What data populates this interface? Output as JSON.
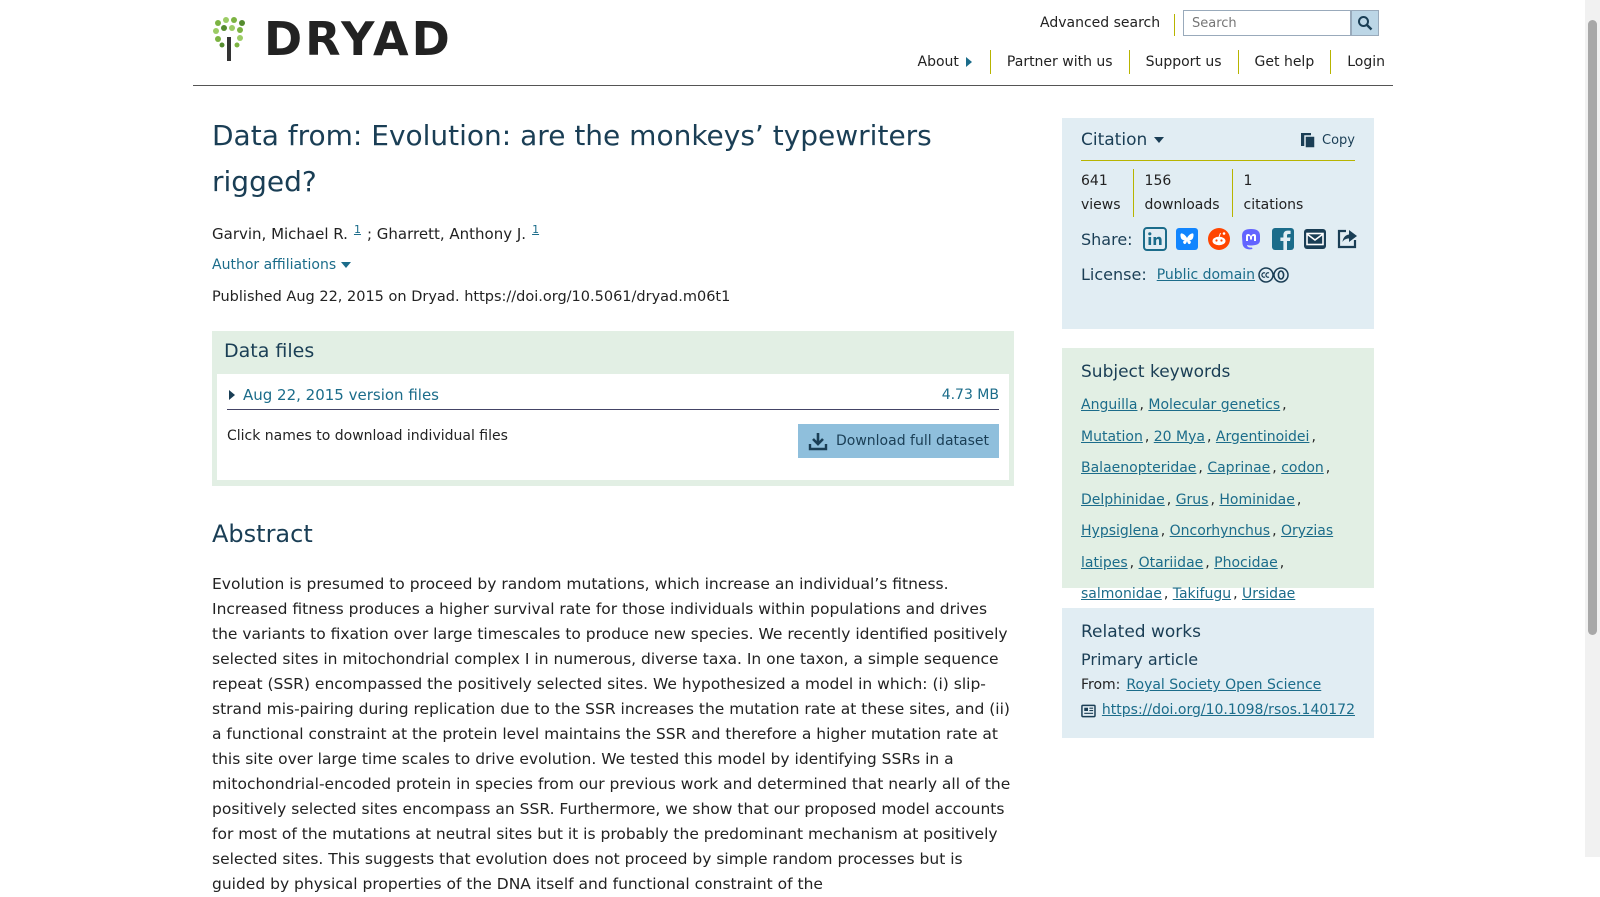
{
  "header": {
    "logo_text": "DRYAD",
    "advanced_search": "Advanced search",
    "search_placeholder": "Search",
    "nav": [
      "About",
      "Partner with us",
      "Support us",
      "Get help",
      "Login"
    ]
  },
  "dataset": {
    "title": "Data from: Evolution: are the monkeys’ typewriters rigged?",
    "author1": "Garvin, Michael R.",
    "author2": "Gharrett, Anthony J.",
    "affil_num": "1",
    "separator": "; ",
    "affiliations_label": "Author affiliations",
    "published": "Published Aug 22, 2015 on Dryad. https://doi.org/10.5061/dryad.m06t1"
  },
  "data_files": {
    "heading": "Data files",
    "version_label": "Aug 22, 2015 version files",
    "size": "4.73 MB",
    "hint": "Click names to download individual files",
    "download_label": "Download full dataset"
  },
  "abstract": {
    "heading": "Abstract",
    "text": "Evolution is presumed to proceed by random mutations, which increase an individual’s fitness. Increased fitness produces a higher survival rate for those individuals within populations and drives the variants to fixation over large timescales to produce new species. We recently identified positively selected sites in mitochondrial complex I in numerous, diverse taxa. In one taxon, a simple sequence repeat (SSR) encompassed the positively selected sites. We hypothesized a model in which: (i) slip-strand mis-pairing during replication due to the SSR increases the mutation rate at these sites, and (ii) a functional constraint at the protein level maintains the SSR and therefore a higher mutation rate at this site over large time scales to drive evolution. We tested this model by identifying SSRs in a mitochondrial-encoded protein in species from our previous work and determined that nearly all of the positively selected sites encompass an SSR. Furthermore, we show that our proposed model accounts for most of the mutations at neutral sites but it is probably the predominant mechanism at positively selected sites. This suggests that evolution does not proceed by simple random processes but is guided by physical properties of the DNA itself and functional constraint of the"
  },
  "citation": {
    "title": "Citation",
    "copy": "Copy",
    "views_num": "641",
    "views_label": "views",
    "downloads_num": "156",
    "downloads_label": "downloads",
    "citations_num": "1",
    "citations_label": "citations",
    "share_label": "Share:",
    "share_icons": [
      "linkedin-icon",
      "bluesky-icon",
      "reddit-icon",
      "mastodon-icon",
      "facebook-icon",
      "email-icon",
      "share-icon"
    ],
    "license_label": "License:",
    "license_value": "Public domain"
  },
  "keywords": {
    "heading": "Subject keywords",
    "items": [
      "Anguilla",
      "Molecular genetics",
      "Mutation",
      "20 Mya",
      "Argentinoidei",
      "Balaenopteridae",
      "Caprinae",
      "codon",
      "Delphinidae",
      "Grus",
      "Hominidae",
      "Hypsiglena",
      "Oncorhynchus",
      "Oryzias latipes",
      "Otariidae",
      "Phocidae",
      "salmonidae",
      "Takifugu",
      "Ursidae"
    ]
  },
  "related": {
    "heading": "Related works",
    "subheading": "Primary article",
    "from_label": "From:",
    "journal": "Royal Society Open Science",
    "doi": "https://doi.org/10.1098/rsos.140172"
  },
  "colors": {
    "accent": "#1b6c8a",
    "heading": "#1a3e55",
    "green_panel": "#e2efe4",
    "blue_panel": "#e1edf3",
    "divider": "#b7b400"
  }
}
